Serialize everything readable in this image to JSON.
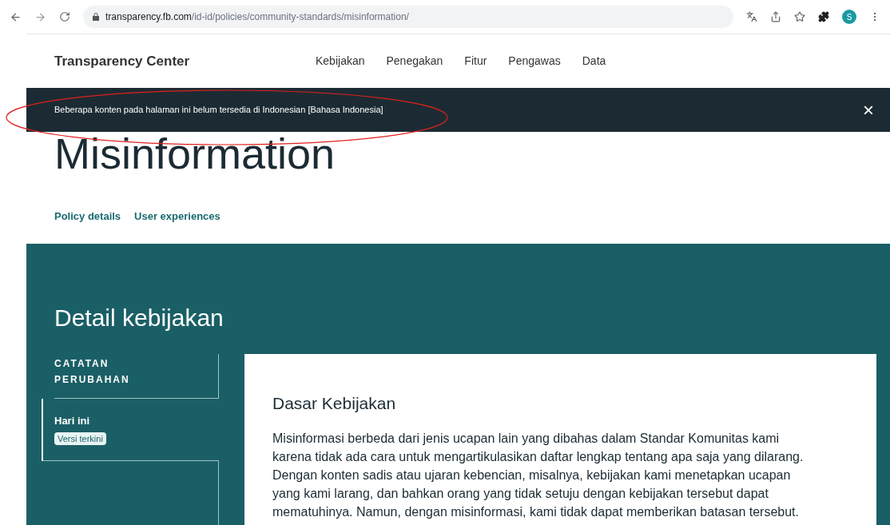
{
  "browser": {
    "url_host": "transparency.fb.com",
    "url_path": "/id-id/policies/community-standards/misinformation/",
    "profile_initial": "S"
  },
  "header": {
    "brand": "Transparency Center",
    "nav": [
      "Kebijakan",
      "Penegakan",
      "Fitur",
      "Pengawas",
      "Data"
    ]
  },
  "banner": {
    "message": "Beberapa konten pada halaman ini belum tersedia di Indonesian [Bahasa Indonesia]",
    "close": "×"
  },
  "page": {
    "title": "Misinformation",
    "tabs": [
      "Policy details",
      "User experiences"
    ]
  },
  "section": {
    "title": "Detail kebijakan",
    "changelog": {
      "heading": "CATATAN PERUBAHAN",
      "items": [
        {
          "label": "Hari ini",
          "badge": "Versi terkini",
          "selected": true
        }
      ]
    },
    "card": {
      "heading": "Dasar Kebijakan",
      "paragraph": "Misinformasi berbeda dari jenis ucapan lain yang dibahas dalam Standar Komunitas kami karena tidak ada cara untuk mengartikulasikan daftar lengkap tentang apa saja yang dilarang. Dengan konten sadis atau ujaran kebencian, misalnya, kebijakan kami menetapkan ucapan yang kami larang, dan bahkan orang yang tidak setuju dengan kebijakan tersebut dapat mematuhinya. Namun, dengan misinformasi, kami tidak dapat memberikan batasan tersebut."
    }
  }
}
